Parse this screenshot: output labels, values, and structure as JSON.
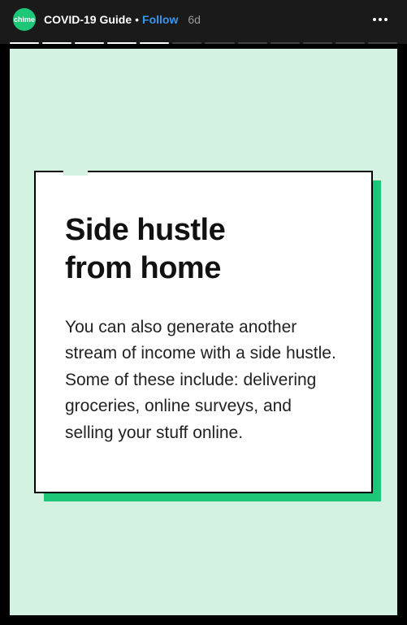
{
  "header": {
    "avatar_label": "chime",
    "title": "COVID-19 Guide",
    "bullet": "•",
    "follow": "Follow",
    "timestamp": "6d"
  },
  "progress": {
    "total_segments": 12,
    "completed_segments": 5
  },
  "story": {
    "heading_line1": "Side hustle",
    "heading_line2": "from home",
    "body": "You can also generate another stream of income with a side hustle. Some of these include: delivering groceries, online surveys, and selling your stuff online."
  }
}
